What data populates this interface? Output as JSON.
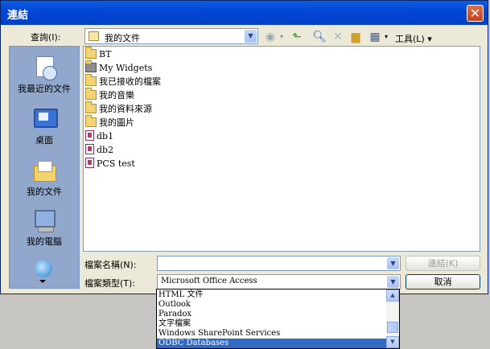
{
  "window": {
    "title": "連結",
    "close_symbol": "✕"
  },
  "lookin": {
    "label": "查詢(I):",
    "value": "我的文件"
  },
  "toolbar": {
    "tools_label": "工具(L)"
  },
  "places": [
    {
      "label": "我最近的文件",
      "icon": "recent-docs-icon"
    },
    {
      "label": "桌面",
      "icon": "desktop-icon"
    },
    {
      "label": "我的文件",
      "icon": "my-documents-icon"
    },
    {
      "label": "我的電腦",
      "icon": "my-computer-icon"
    },
    {
      "label": "",
      "icon": "network-places-icon"
    }
  ],
  "files": [
    {
      "name": "BT",
      "type": "folder"
    },
    {
      "name": "My Widgets",
      "type": "folder"
    },
    {
      "name": "我已接收的檔案",
      "type": "folder"
    },
    {
      "name": "我的音樂",
      "type": "folder"
    },
    {
      "name": "我的資料來源",
      "type": "folder"
    },
    {
      "name": "我的圖片",
      "type": "folder"
    },
    {
      "name": "db1",
      "type": "access"
    },
    {
      "name": "db2",
      "type": "access"
    },
    {
      "name": "PCS test",
      "type": "access"
    }
  ],
  "filename": {
    "label": "檔案名稱(N):",
    "value": ""
  },
  "filetype": {
    "label": "檔案類型(T):",
    "value": "Microsoft Office Access",
    "options": [
      "HTML 文件",
      "Outlook",
      "Paradox",
      "文字檔案",
      "Windows SharePoint Services",
      "ODBC Databases"
    ],
    "selected_option": "ODBC Databases"
  },
  "buttons": {
    "link": "連結(K)",
    "cancel": "取消"
  },
  "colors": {
    "title_bar": "#0346d6",
    "selection": "#316ac5",
    "places_bar": "#91a8cc",
    "dialog_bg": "#ece9d8"
  }
}
